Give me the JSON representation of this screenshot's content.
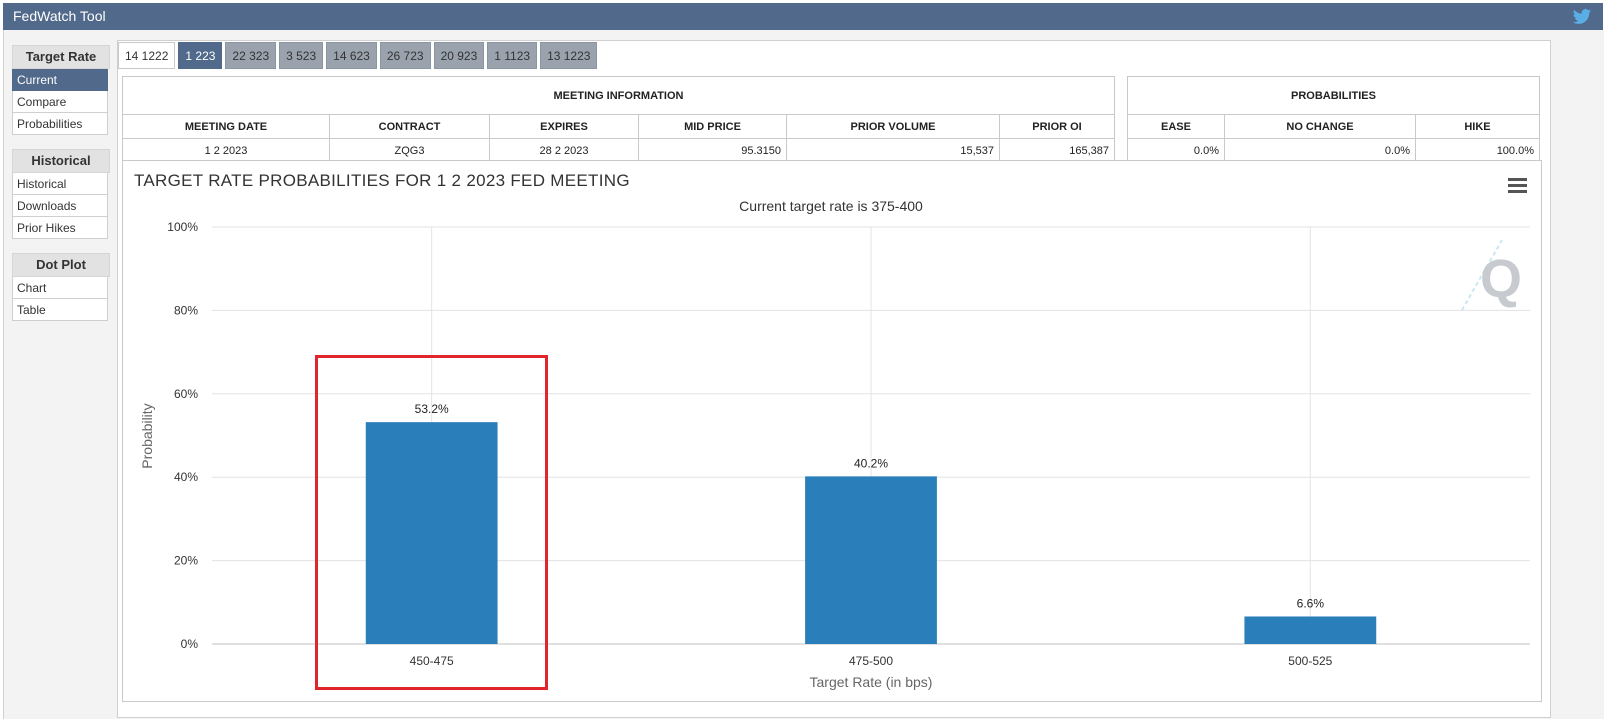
{
  "app": {
    "title": "FedWatch Tool",
    "twitter_icon": "twitter-bird-icon"
  },
  "sidebar": {
    "sections": [
      {
        "heading": "Target Rate",
        "items": [
          "Current",
          "Compare",
          "Probabilities"
        ],
        "active": 0
      },
      {
        "heading": "Historical",
        "items": [
          "Historical",
          "Downloads",
          "Prior Hikes"
        ],
        "active": -1
      },
      {
        "heading": "Dot Plot",
        "items": [
          "Chart",
          "Table"
        ],
        "active": -1
      }
    ]
  },
  "tabs": {
    "labels": [
      "14 1222",
      "1 223",
      "22 323",
      "3 523",
      "14 623",
      "26 723",
      "20 923",
      "1 1123",
      "13 1223"
    ],
    "active": 1
  },
  "meeting_info": {
    "title": "MEETING INFORMATION",
    "columns": [
      "MEETING DATE",
      "CONTRACT",
      "EXPIRES",
      "MID PRICE",
      "PRIOR VOLUME",
      "PRIOR OI"
    ],
    "row": [
      "1 2 2023",
      "ZQG3",
      "28 2 2023",
      "95.3150",
      "15,537",
      "165,387"
    ]
  },
  "probabilities": {
    "title": "PROBABILITIES",
    "columns": [
      "EASE",
      "NO CHANGE",
      "HIKE"
    ],
    "row": [
      "0.0%",
      "0.0%",
      "100.0%"
    ]
  },
  "chart": {
    "menu_icon": "hamburger-menu-icon",
    "watermark": "Q"
  },
  "chart_data": {
    "type": "bar",
    "title": "TARGET RATE PROBABILITIES FOR 1 2 2023 FED MEETING",
    "subtitle": "Current target rate is 375-400",
    "xlabel": "Target Rate (in bps)",
    "ylabel": "Probability",
    "categories": [
      "450-475",
      "475-500",
      "500-525"
    ],
    "values": [
      53.2,
      40.2,
      6.6
    ],
    "value_labels": [
      "53.2%",
      "40.2%",
      "6.6%"
    ],
    "ylim": [
      0,
      100
    ],
    "yticks": [
      "0%",
      "20%",
      "40%",
      "60%",
      "80%",
      "100%"
    ],
    "color": "#2a7fba",
    "grid": true
  },
  "colors": {
    "header": "#51698a",
    "bar": "#2a7fba",
    "highlight": "#e2252d"
  }
}
